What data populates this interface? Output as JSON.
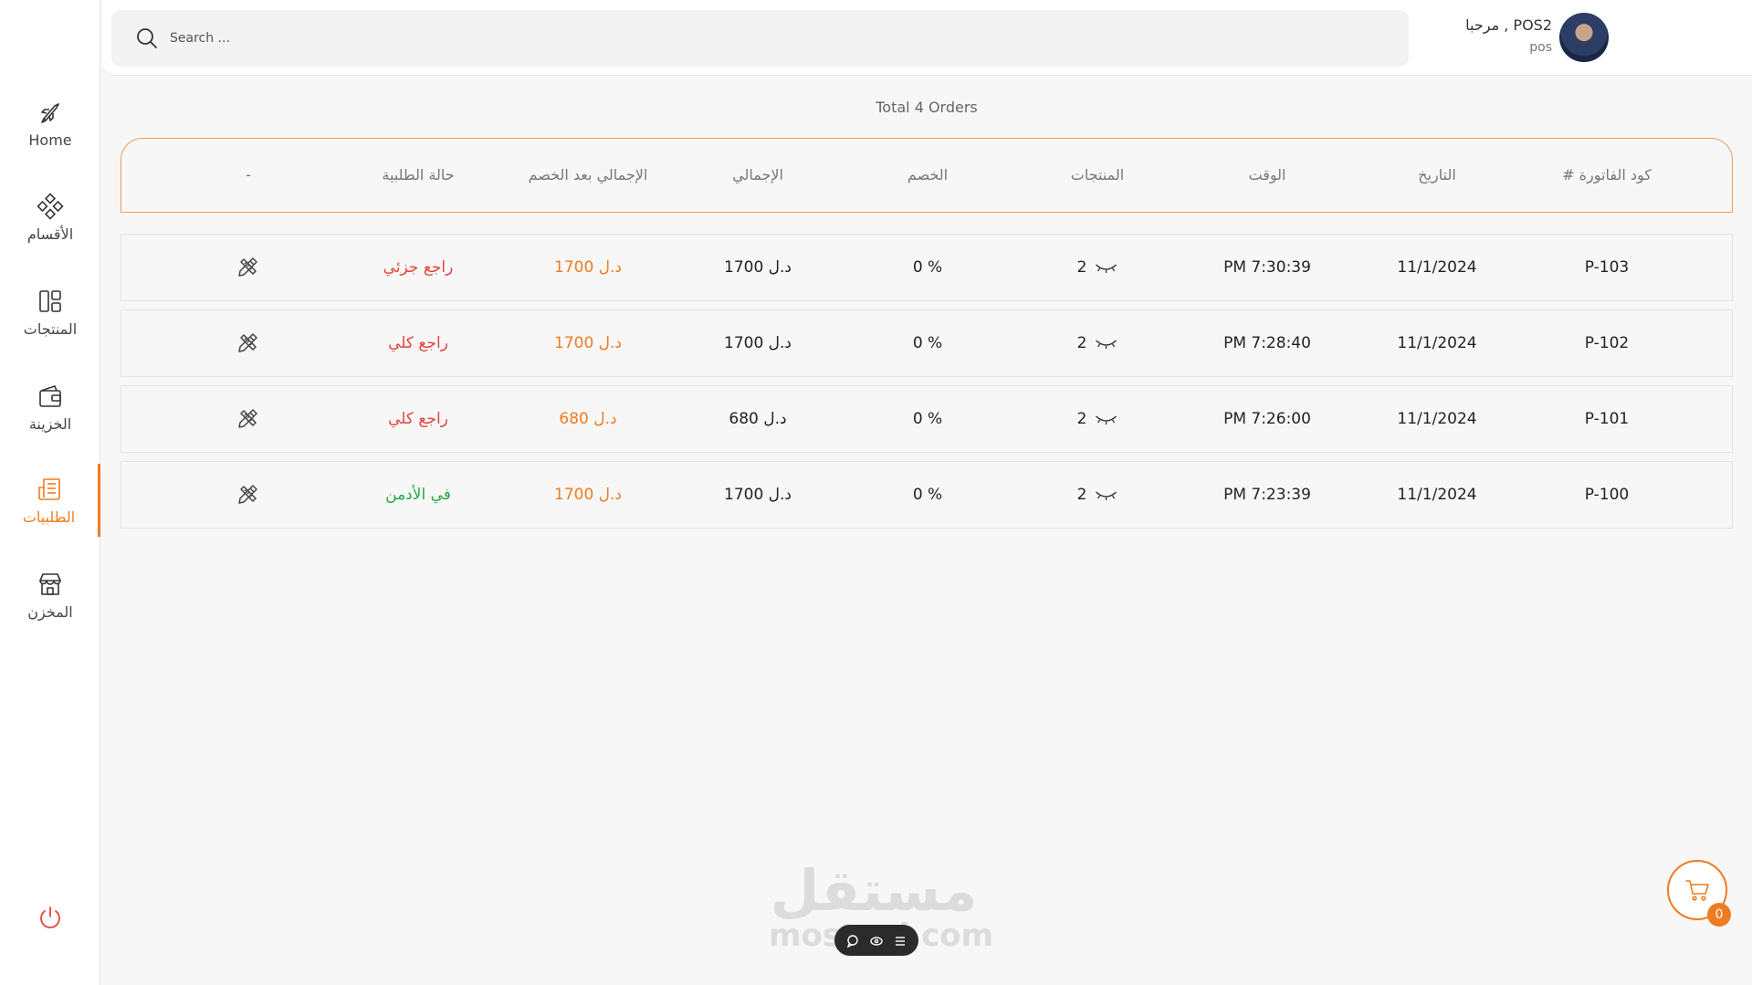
{
  "sidebar": {
    "items": [
      {
        "label": "Home",
        "icon": "rocket-icon"
      },
      {
        "label": "الأقسام",
        "icon": "categories-icon"
      },
      {
        "label": "المنتجات",
        "icon": "products-grid-icon"
      },
      {
        "label": "الخزينة",
        "icon": "wallet-icon"
      },
      {
        "label": "الطلبيات",
        "icon": "orders-icon",
        "active": true
      },
      {
        "label": "المخزن",
        "icon": "store-icon"
      }
    ],
    "logout_icon": "power-icon"
  },
  "header": {
    "search_placeholder": "Search ...",
    "greeting": "مرحبا , POS2",
    "role": "pos"
  },
  "orders": {
    "total_text": "Total 4 Orders",
    "columns": [
      "# كود الفاتورة",
      "التاريخ",
      "الوقت",
      "المنتجات",
      "الخصم",
      "الإجمالي",
      "الإجمالي بعد الخصم",
      "حالة الطلبية",
      "-"
    ],
    "rows": [
      {
        "code": "P-103",
        "date": "11/1/2024",
        "time": "PM 7:30:39",
        "products": "2",
        "discount": "0 %",
        "total": "1700 د.ل",
        "total_after": "1700 د.ل",
        "status": "راجع جزئي",
        "status_type": "returned"
      },
      {
        "code": "P-102",
        "date": "11/1/2024",
        "time": "PM 7:28:40",
        "products": "2",
        "discount": "0 %",
        "total": "1700 د.ل",
        "total_after": "1700 د.ل",
        "status": "راجع كلي",
        "status_type": "returned"
      },
      {
        "code": "P-101",
        "date": "11/1/2024",
        "time": "PM 7:26:00",
        "products": "2",
        "discount": "0 %",
        "total": "680 د.ل",
        "total_after": "680 د.ل",
        "status": "راجع كلي",
        "status_type": "returned"
      },
      {
        "code": "P-100",
        "date": "11/1/2024",
        "time": "PM 7:23:39",
        "products": "2",
        "discount": "0 %",
        "total": "1700 د.ل",
        "total_after": "1700 د.ل",
        "status": "في الأدمن",
        "status_type": "admin"
      }
    ]
  },
  "cart": {
    "count": "0"
  },
  "watermark": {
    "arabic": "مستقل",
    "latin": "mostaql.com"
  },
  "colors": {
    "accent": "#f07b20",
    "returned": "#e4433a",
    "admin": "#27a844"
  }
}
